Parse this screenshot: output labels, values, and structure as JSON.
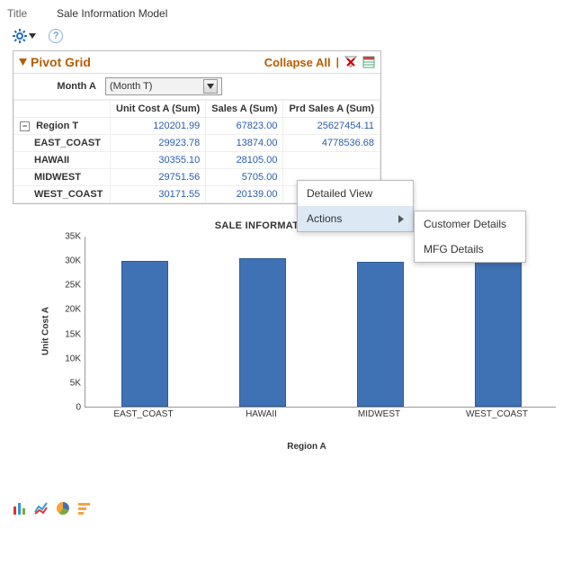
{
  "title": {
    "label": "Title",
    "value": "Sale Information Model"
  },
  "grid": {
    "title": "Pivot Grid",
    "collapse": "Collapse All",
    "filter_label": "Month A",
    "filter_value": "(Month T)",
    "columns": [
      "Unit Cost A (Sum)",
      "Sales A (Sum)",
      "Prd Sales A (Sum)"
    ],
    "total_row": {
      "label": "Region T",
      "values": [
        "120201.99",
        "67823.00",
        "25627454.11"
      ]
    },
    "rows": [
      {
        "label": "EAST_COAST",
        "values": [
          "29923.78",
          "13874.00",
          "4778536.68"
        ]
      },
      {
        "label": "HAWAII",
        "values": [
          "30355.10",
          "28105.00",
          ""
        ]
      },
      {
        "label": "MIDWEST",
        "values": [
          "29751.56",
          "5705.00",
          ""
        ]
      },
      {
        "label": "WEST_COAST",
        "values": [
          "30171.55",
          "20139.00",
          ""
        ]
      }
    ]
  },
  "context_menu": {
    "item1": "Detailed View",
    "item2": "Actions",
    "sub1": "Customer Details",
    "sub2": "MFG Details"
  },
  "chart_data": {
    "type": "bar",
    "title": "SALE INFORMATION MODEL",
    "xlabel": "Region A",
    "ylabel": "Unit Cost A",
    "ylim": [
      0,
      35000
    ],
    "yticks": [
      0,
      5000,
      10000,
      15000,
      20000,
      25000,
      30000,
      35000
    ],
    "ytick_labels": [
      "0",
      "5K",
      "10K",
      "15K",
      "20K",
      "25K",
      "30K",
      "35K"
    ],
    "categories": [
      "EAST_COAST",
      "HAWAII",
      "MIDWEST",
      "WEST_COAST"
    ],
    "values": [
      29923.78,
      30355.1,
      29751.56,
      30171.55
    ]
  }
}
